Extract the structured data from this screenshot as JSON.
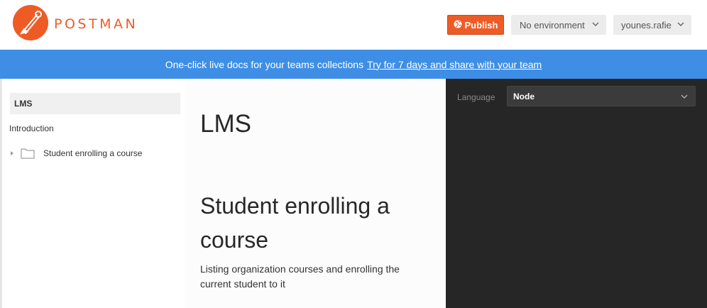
{
  "header": {
    "brand": "POSTMAN",
    "publish_label": "Publish",
    "environment_value": "No environment",
    "user_value": "younes.rafie"
  },
  "banner": {
    "text": "One-click live docs for your teams collections",
    "link_text": "Try for 7 days and share with your team"
  },
  "sidebar": {
    "collection": "LMS",
    "introduction": "Introduction",
    "folder_label": "Student enrolling a course"
  },
  "main": {
    "title": "LMS",
    "section_title": "Student enrolling a course",
    "section_description": "Listing organization courses and enrolling the current student to it"
  },
  "code_panel": {
    "language_label": "Language",
    "language_value": "Node"
  },
  "icons": {
    "logo": "postman-logo-icon",
    "publish": "globe-icon",
    "dropdown": "chevron-down-icon",
    "folder": "folder-icon",
    "caret": "caret-right-icon"
  },
  "colors": {
    "brand_orange": "#ef5b25",
    "banner_blue": "#3f8ee6",
    "dark_panel": "#262626"
  }
}
